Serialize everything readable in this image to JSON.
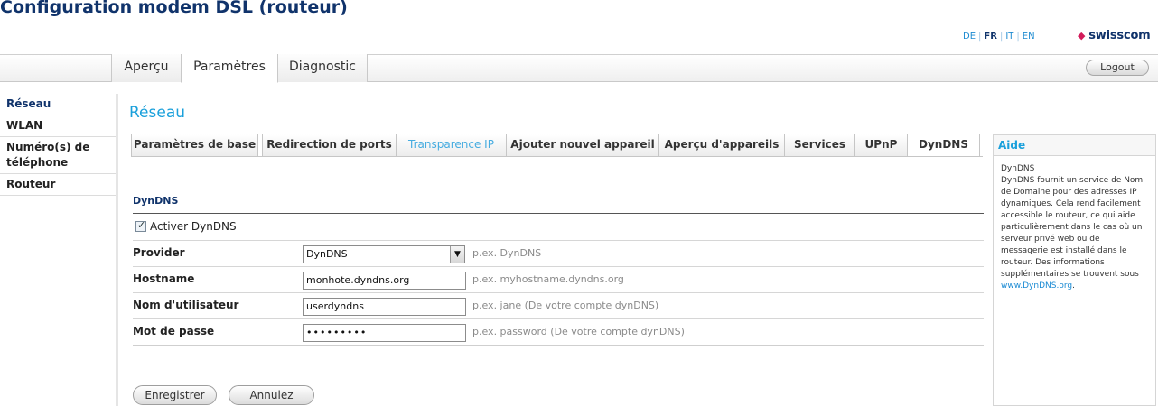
{
  "page": {
    "title": "Configuration modem DSL (routeur)"
  },
  "languages": [
    {
      "code": "DE",
      "active": false
    },
    {
      "code": "FR",
      "active": true
    },
    {
      "code": "IT",
      "active": false
    },
    {
      "code": "EN",
      "active": false
    }
  ],
  "brand": {
    "name": "swisscom"
  },
  "mainnav": {
    "tabs": [
      {
        "label": "Aperçu"
      },
      {
        "label": "Paramètres"
      },
      {
        "label": "Diagnostic"
      }
    ],
    "logout_label": "Logout"
  },
  "sidebar": {
    "items": [
      {
        "label": "Réseau"
      },
      {
        "label": "WLAN"
      },
      {
        "label": "Numéro(s) de téléphone"
      },
      {
        "label": "Routeur"
      }
    ]
  },
  "section": {
    "title": "Réseau"
  },
  "subtabs": [
    {
      "label": "Paramètres de base"
    },
    {
      "label": "Redirection de ports"
    },
    {
      "label": "Transparence IP"
    },
    {
      "label": "Ajouter nouvel appareil"
    },
    {
      "label": "Aperçu d'appareils"
    },
    {
      "label": "Services"
    },
    {
      "label": "UPnP"
    },
    {
      "label": "DynDNS"
    }
  ],
  "form": {
    "title": "DynDNS",
    "enable_label": "Activer DynDNS",
    "enable_checked": true,
    "rows": [
      {
        "label": "Provider",
        "value": "DynDNS",
        "hint": "p.ex. DynDNS"
      },
      {
        "label": "Hostname",
        "value": "monhote.dyndns.org",
        "hint": "p.ex. myhostname.dyndns.org"
      },
      {
        "label": "Nom d'utilisateur",
        "value": "userdyndns",
        "hint": "p.ex. jane (De votre compte dynDNS)"
      },
      {
        "label": "Mot de passe",
        "value": "•••••••••",
        "hint": "p.ex. password (De votre compte dynDNS)"
      }
    ],
    "save_label": "Enregistrer",
    "cancel_label": "Annulez"
  },
  "help": {
    "title": "Aide",
    "heading": "DynDNS",
    "text": "DynDNS fournit un service de Nom de Domaine pour des adresses IP dynamiques. Cela rend facilement accessible le routeur, ce qui aide particulièrement dans le cas où un serveur privé web ou de messagerie est installé dans le routeur. Des informations supplémentaires se trouvent sous",
    "link": "www.DynDNS.org",
    "tail": "."
  },
  "colors": {
    "brand_navy": "#10336b",
    "accent_blue": "#1aa0db",
    "brand_magenta": "#d21c5b"
  }
}
